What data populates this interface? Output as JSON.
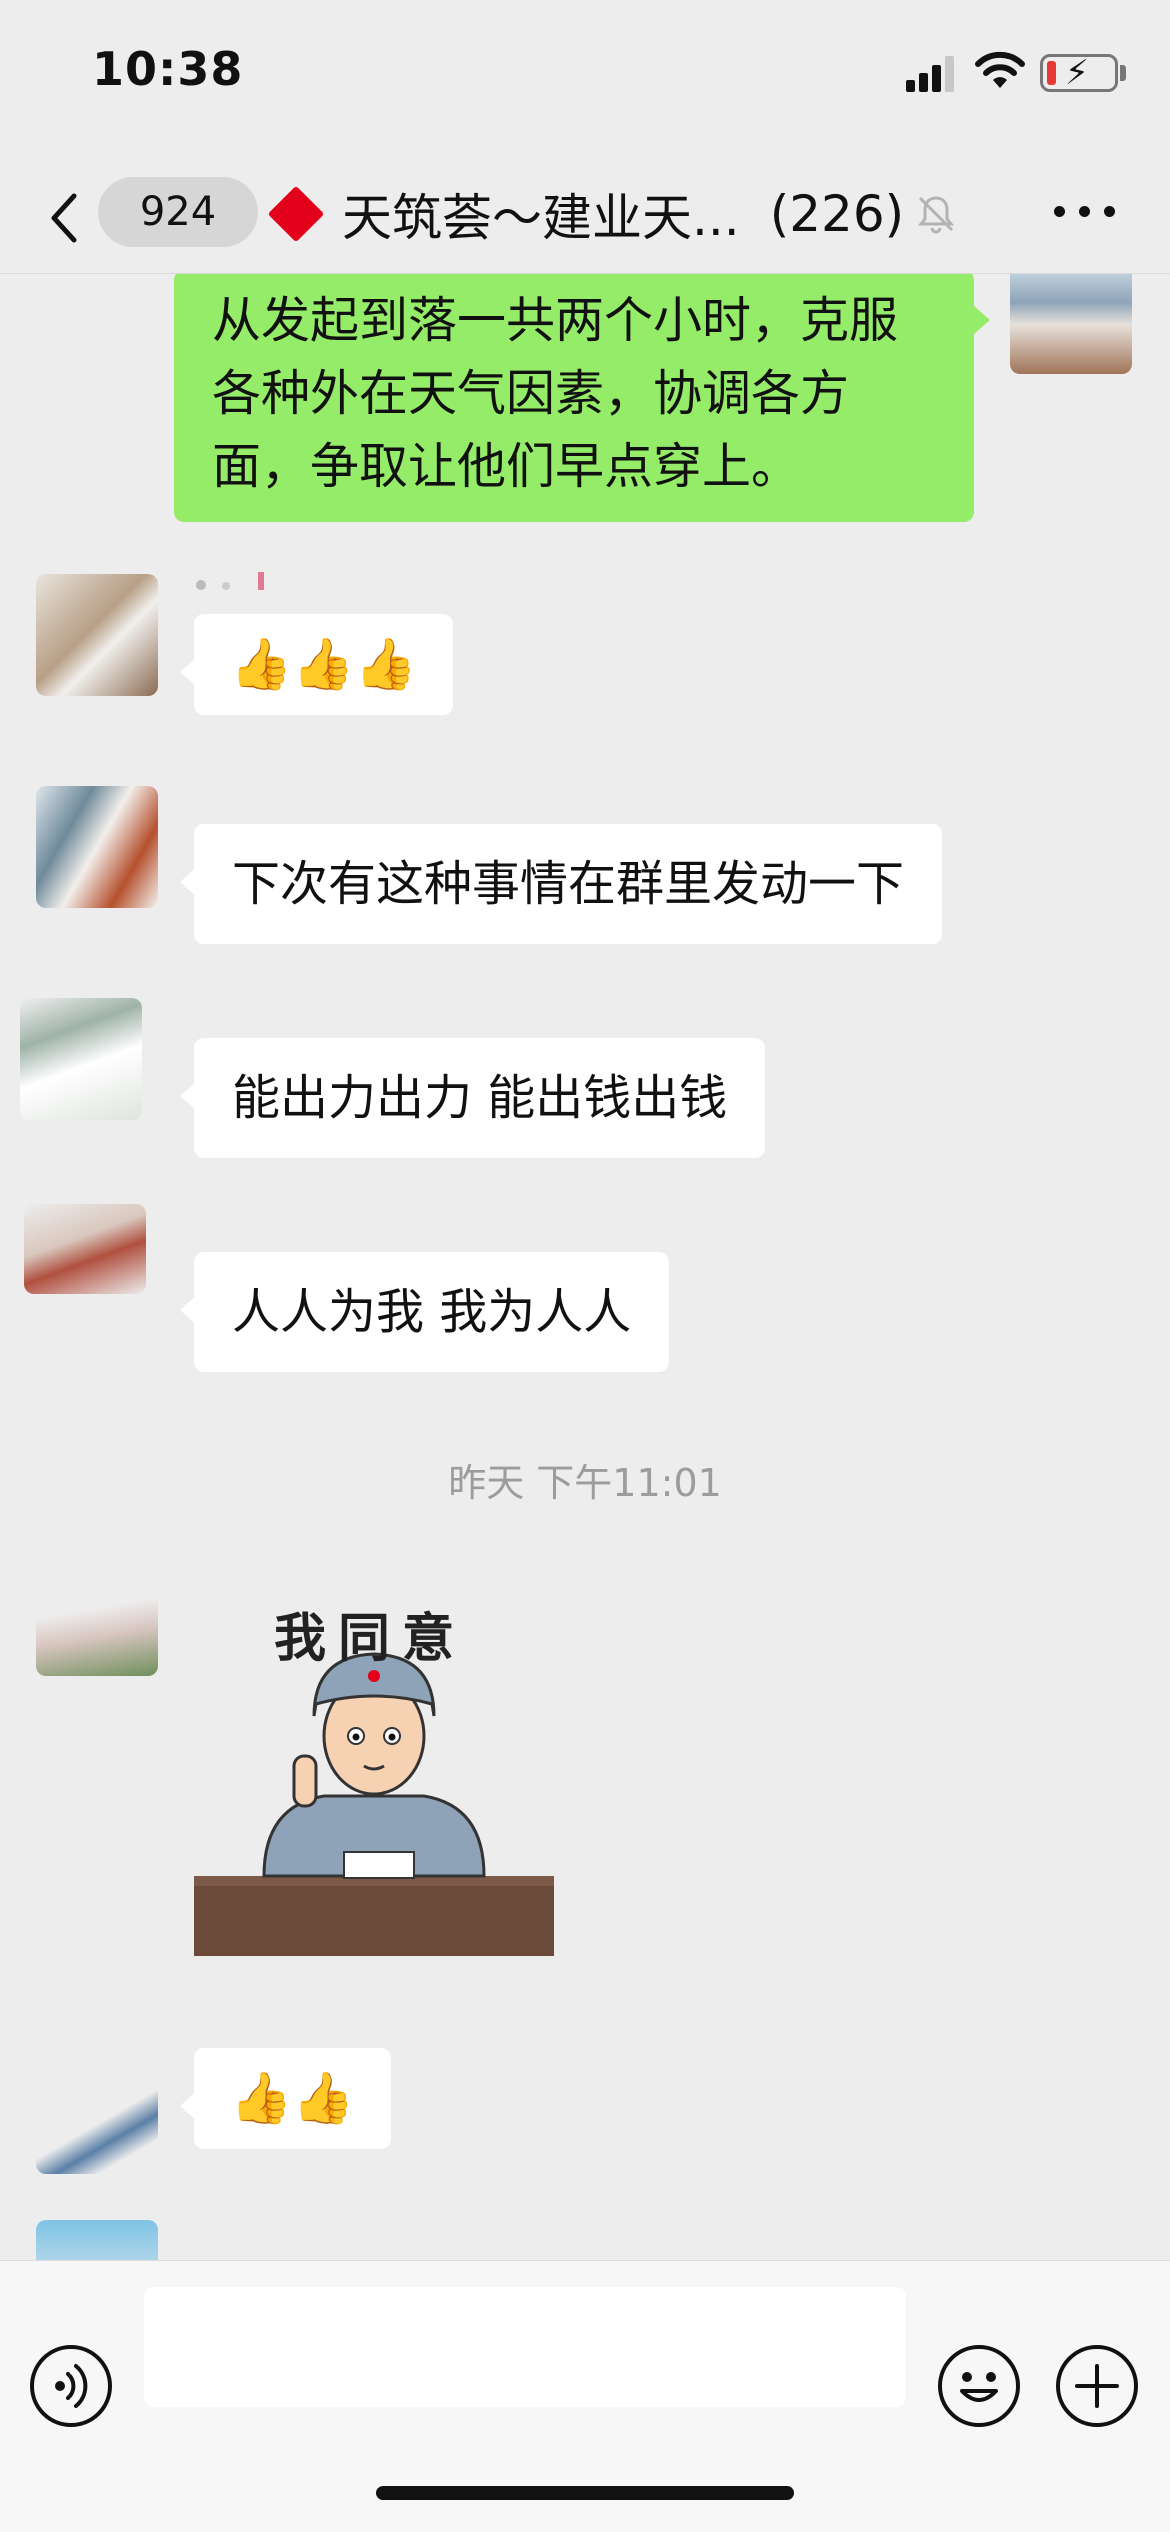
{
  "status_bar": {
    "time": "10:38",
    "icons": [
      "cellular-signal-icon",
      "wifi-icon",
      "battery-charging-icon"
    ],
    "battery_color": "#e53935"
  },
  "nav": {
    "unread_count": "924",
    "title": "天筑荟～建业天...",
    "member_count": "(226)",
    "icons": [
      "back-chevron-icon",
      "red-diamond-icon",
      "mute-bell-icon",
      "more-dots-icon"
    ],
    "accent_color": "#e3001b"
  },
  "messages": [
    {
      "direction": "outgoing",
      "type": "text",
      "lines": [
        "从发起到落一共两个小时，克服",
        "各种外在天气因素，协调各方",
        "面，争取让他们早点穿上。"
      ]
    },
    {
      "direction": "incoming",
      "type": "emoji",
      "content": "👍👍👍"
    },
    {
      "direction": "incoming",
      "type": "text",
      "content": "下次有这种事情在群里发动一下"
    },
    {
      "direction": "incoming",
      "type": "text",
      "content": "能出力出力 能出钱出钱"
    },
    {
      "direction": "incoming",
      "type": "text",
      "content": "人人为我 我为人人"
    },
    {
      "type": "timestamp",
      "content": "昨天 下午11:01"
    },
    {
      "direction": "incoming",
      "type": "sticker",
      "caption": "我同意"
    },
    {
      "direction": "incoming",
      "type": "emoji",
      "content": "👍👍"
    }
  ],
  "input_bar": {
    "placeholder": "",
    "icons": [
      "voice-icon",
      "emoji-icon",
      "plus-icon"
    ]
  },
  "colors": {
    "background": "#ededed",
    "outgoing_bubble": "#95ec69",
    "incoming_bubble": "#ffffff",
    "timestamp_text": "#9c9c9c"
  }
}
